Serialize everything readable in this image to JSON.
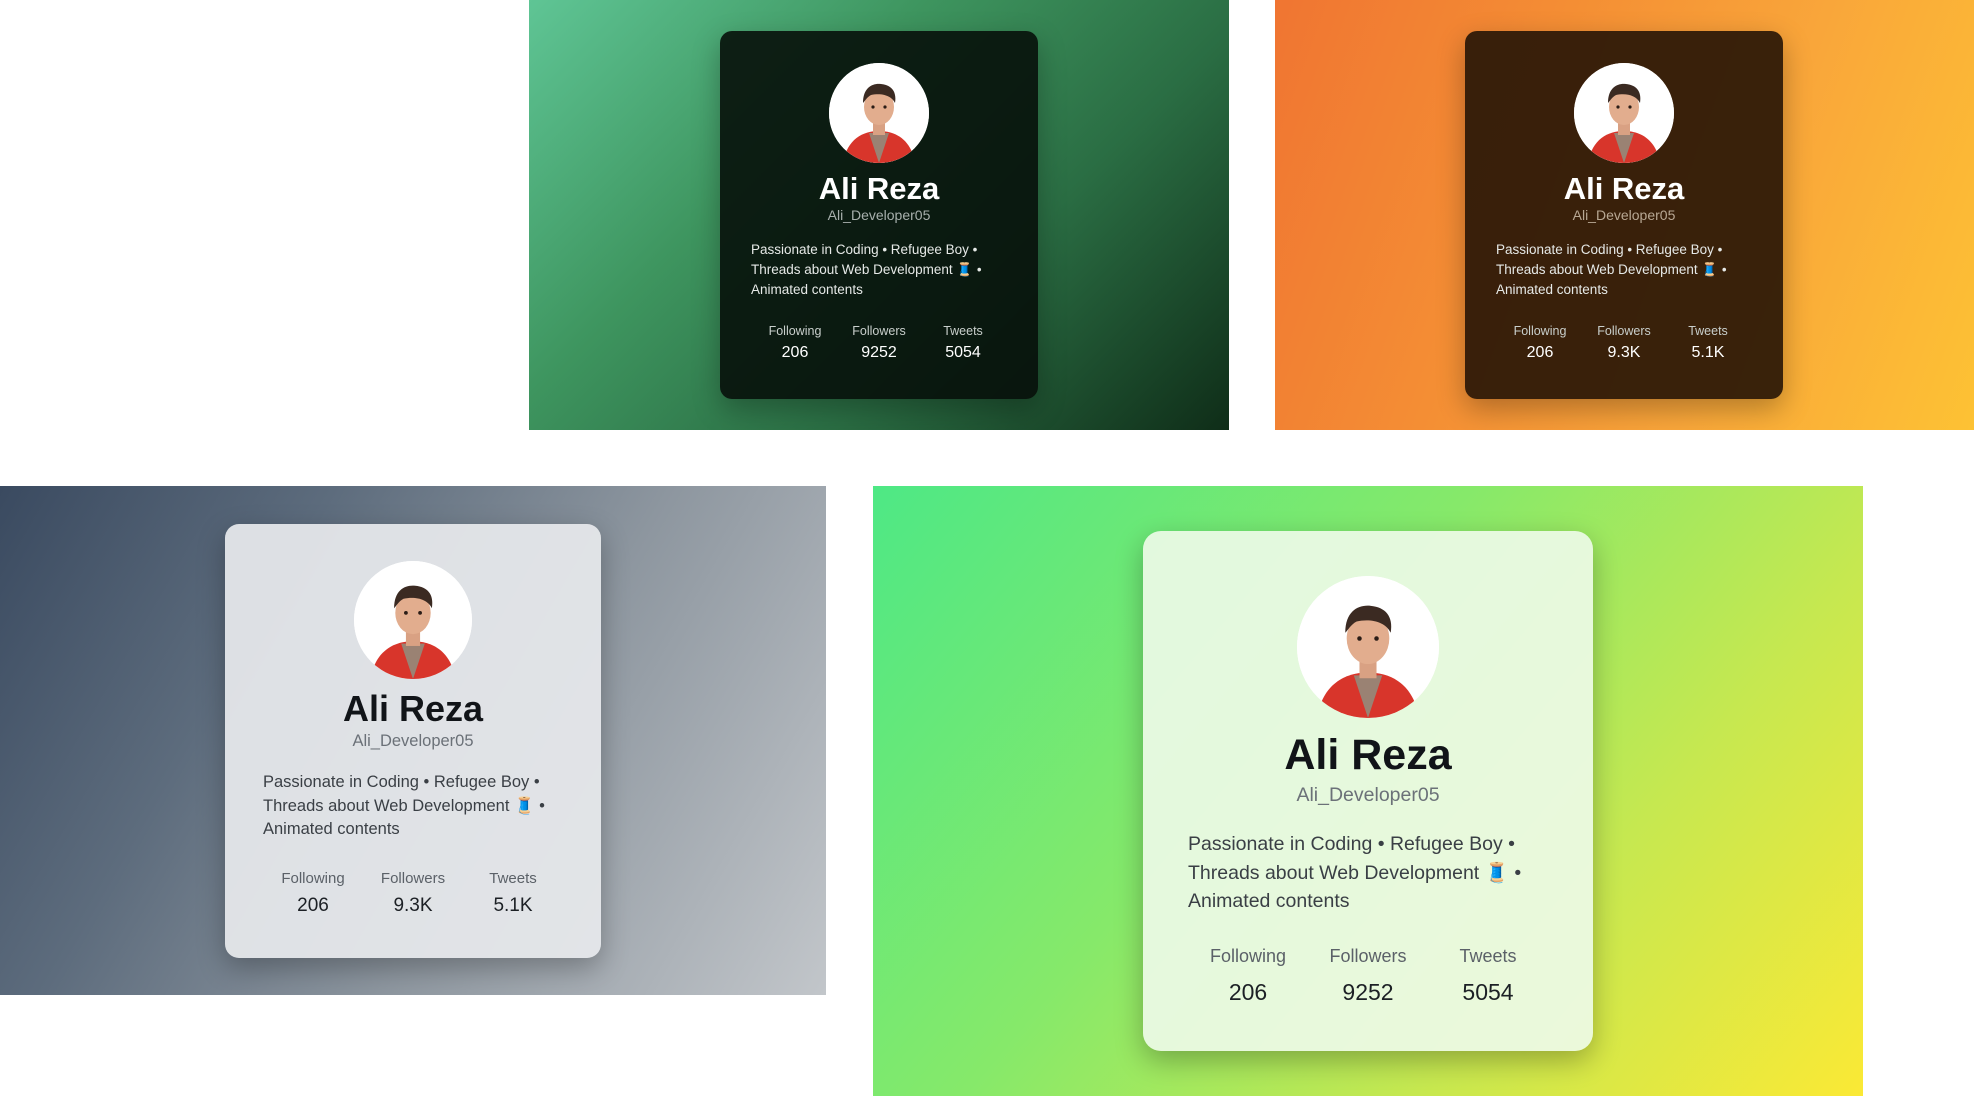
{
  "profile_cards": [
    {
      "name": "Ali Reza",
      "handle": "Ali_Developer05",
      "bio": "Passionate in Coding • Refugee Boy • Threads about Web Development 🧵 • Animated contents",
      "stats": [
        {
          "label": "Following",
          "value": "206"
        },
        {
          "label": "Followers",
          "value": "9252"
        },
        {
          "label": "Tweets",
          "value": "5054"
        }
      ]
    },
    {
      "name": "Ali Reza",
      "handle": "Ali_Developer05",
      "bio": "Passionate in Coding • Refugee Boy • Threads about Web Development 🧵 • Animated contents",
      "stats": [
        {
          "label": "Following",
          "value": "206"
        },
        {
          "label": "Followers",
          "value": "9.3K"
        },
        {
          "label": "Tweets",
          "value": "5.1K"
        }
      ]
    },
    {
      "name": "Ali Reza",
      "handle": "Ali_Developer05",
      "bio": "Passionate in Coding • Refugee Boy • Threads about Web Development 🧵 • Animated contents",
      "stats": [
        {
          "label": "Following",
          "value": "206"
        },
        {
          "label": "Followers",
          "value": "9.3K"
        },
        {
          "label": "Tweets",
          "value": "5.1K"
        }
      ]
    },
    {
      "name": "Ali Reza",
      "handle": "Ali_Developer05",
      "bio": "Passionate in Coding • Refugee Boy • Threads about Web Development 🧵 • Animated contents",
      "stats": [
        {
          "label": "Following",
          "value": "206"
        },
        {
          "label": "Followers",
          "value": "9252"
        },
        {
          "label": "Tweets",
          "value": "5054"
        }
      ]
    }
  ],
  "icons": {
    "avatar": "avatar-photo-icon",
    "thread": "thread-spool-icon"
  },
  "colors": {
    "green_bg_start": "#5fc595",
    "green_bg_end": "#0f2d18",
    "orange_bg_start": "#f07532",
    "orange_bg_end": "#fdc234",
    "slate_bg_start": "#3a4a60",
    "slate_bg_end": "#c2c6ca",
    "lime_bg_start": "#4ee885",
    "lime_bg_end": "#fbe935"
  }
}
